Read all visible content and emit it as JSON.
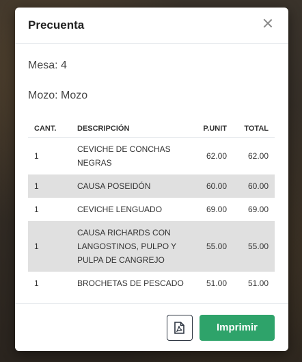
{
  "modal": {
    "title": "Precuenta",
    "mesa": "Mesa: 4",
    "mozo": "Mozo: Mozo"
  },
  "table": {
    "headers": [
      "CANT.",
      "DESCRIPCIÓN",
      "P.UNIT",
      "TOTAL"
    ],
    "rows": [
      {
        "cant": "1",
        "desc": "CEVICHE DE CONCHAS NEGRAS",
        "punit": "62.00",
        "total": "62.00"
      },
      {
        "cant": "1",
        "desc": "CAUSA POSEIDÓN",
        "punit": "60.00",
        "total": "60.00"
      },
      {
        "cant": "1",
        "desc": "CEVICHE LENGUADO",
        "punit": "69.00",
        "total": "69.00"
      },
      {
        "cant": "1",
        "desc": "CAUSA RICHARDS CON LANGOSTINOS, PULPO Y PULPA DE CANGREJO",
        "punit": "55.00",
        "total": "55.00"
      },
      {
        "cant": "1",
        "desc": "BROCHETAS DE PESCADO",
        "punit": "51.00",
        "total": "51.00"
      }
    ]
  },
  "footer": {
    "pdf_icon": "file-pdf-icon",
    "print_label": "Imprimir"
  },
  "colors": {
    "primary_button": "#2ea36a",
    "striped_row": "#e0e0e0"
  }
}
